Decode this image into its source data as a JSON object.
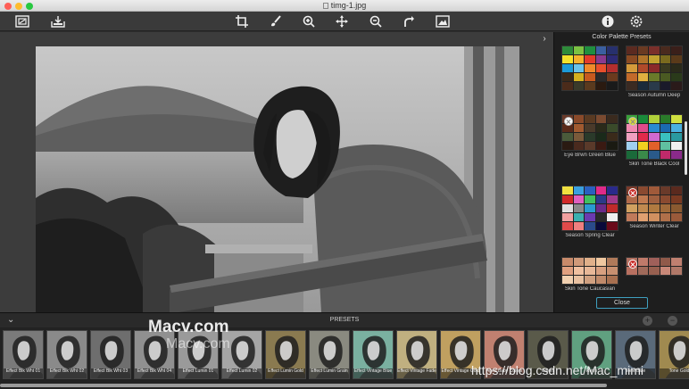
{
  "window": {
    "title": "timg-1.jpg",
    "lights": [
      "#fe5f57",
      "#febc2e",
      "#28c840"
    ]
  },
  "toolbar": {
    "left_icons": [
      "compare-icon",
      "save-icon"
    ],
    "center_icons": [
      "crop-icon",
      "brush-icon",
      "zoom-in-icon",
      "move-icon",
      "zoom-out-icon",
      "redo-icon",
      "fit-screen-icon"
    ],
    "right_icons": [
      "info-icon",
      "settings-icon"
    ]
  },
  "panel": {
    "title": "Color Palette Presets",
    "close_label": "Close",
    "palettes": [
      {
        "label": "",
        "badge": "none",
        "colors": [
          "#2e8b3a",
          "#7cc242",
          "#1f8f3f",
          "#3b5fa0",
          "#27306d",
          "#f2e22b",
          "#f6b12c",
          "#e33b2a",
          "#8a3a8e",
          "#2d2a75",
          "#1c9ad6",
          "#6bc3e9",
          "#f08a2a",
          "#e84f2c",
          "#b32e2e",
          "#3a2a1a",
          "#d4b020",
          "#c65a1f",
          "#2a2a2a",
          "#6b3a1e",
          "#4b2b1a",
          "#3a3a2a",
          "#5a3a1e",
          "#2a1a10",
          "#1a1a1a"
        ]
      },
      {
        "label": "Season Autumn Deep",
        "badge": "none",
        "colors": [
          "#5b2a20",
          "#6a3a22",
          "#7a2f2a",
          "#4a2a1e",
          "#3a1f1a",
          "#8a4a22",
          "#b0742a",
          "#c2a230",
          "#7a6a1e",
          "#5a3a1a",
          "#d49a3a",
          "#b04a2a",
          "#8a2a2a",
          "#3a3a20",
          "#2a2a1a",
          "#c26a2a",
          "#e0b040",
          "#6a7a2a",
          "#4a5a22",
          "#2a3a1a",
          "#3a2a22",
          "#1a2a3a",
          "#2a3a4a",
          "#1a1a2a",
          "#2a1a1a"
        ]
      },
      {
        "label": "Eye Brwn Green Blue",
        "badge": "grey",
        "colors": [
          "#6a3a2a",
          "#8a4a2a",
          "#5a3a22",
          "#7a4a30",
          "#3a2a1e",
          "#5a2a1a",
          "#a05a30",
          "#4a3a2a",
          "#2a2a1a",
          "#3a4a2a",
          "#4a5a3a",
          "#7a5a3a",
          "#2a3a2a",
          "#1a2a1a",
          "#3a2a1a",
          "#2a1a12",
          "#4a2a1e",
          "#5a3a2a",
          "#3a1a12",
          "#1a1a12"
        ]
      },
      {
        "label": "Skin Tone Black Cool",
        "badge": "yel",
        "colors": [
          "#3aa03a",
          "#1a8a3a",
          "#b0d03a",
          "#2a7a2a",
          "#d0e040",
          "#f08ab0",
          "#e04a8a",
          "#2a8ad0",
          "#1a6ab0",
          "#4ab0e0",
          "#f0a0c0",
          "#e02a4a",
          "#d06ad0",
          "#3ac0c0",
          "#2a9aa0",
          "#a0d0f0",
          "#f0d020",
          "#e0602a",
          "#60c0a0",
          "#f0f0f0",
          "#1a6a3a",
          "#3a8a4a",
          "#2a5a8a",
          "#c02a6a",
          "#8a2a8a"
        ]
      },
      {
        "label": "Season Spring Clear",
        "badge": "none",
        "colors": [
          "#f0e040",
          "#3aa0e0",
          "#2a60c0",
          "#e02a8a",
          "#2a2a8a",
          "#d02a2a",
          "#e060c0",
          "#40c060",
          "#2a3a8a",
          "#a03a8a",
          "#e0e0e0",
          "#8a8a8a",
          "#2a9ad0",
          "#6a2a8a",
          "#c02a2a",
          "#f0a0a0",
          "#3ab0b0",
          "#6a3ab0",
          "#2a2a2a",
          "#f0f0f0",
          "#e04a4a",
          "#f08080",
          "#2a4a8a",
          "#0a0a3a",
          "#6a0a1a"
        ]
      },
      {
        "label": "Season Winter Clear",
        "badge": "red",
        "colors": [
          "#7a3a2a",
          "#8a4a30",
          "#a05a3a",
          "#6a3a2a",
          "#5a2a1e",
          "#b06a4a",
          "#c07a50",
          "#a06040",
          "#8a4a30",
          "#7a3a22",
          "#d0a060",
          "#c08a50",
          "#b07a40",
          "#a06a3a",
          "#8a5a30",
          "#c07a5a",
          "#e0a070",
          "#d09060",
          "#b0704a",
          "#9a5a3a"
        ]
      },
      {
        "label": "Skin Tone Caucasian",
        "badge": "none",
        "colors": [
          "#c88a6a",
          "#d09a7a",
          "#e0b08a",
          "#f0c8a0",
          "#b07a5a",
          "#e0a080",
          "#f0c0a0",
          "#e8b898",
          "#d8a080",
          "#c89070",
          "#f0d0b0",
          "#e8c0a0",
          "#d0a080",
          "#c08a6a",
          "#a87050"
        ]
      },
      {
        "label": "",
        "badge": "red",
        "colors": [
          "#b07060",
          "#c07a6a",
          "#a0605a",
          "#905a4a",
          "#c08070",
          "#b87060",
          "#a06a5a",
          "#986050",
          "#c88878",
          "#b07868"
        ]
      }
    ]
  },
  "presets": {
    "label": "PRESETS",
    "items": [
      {
        "label": "Effect Blk Wht 01",
        "tint": "#7a7a7a"
      },
      {
        "label": "Effect Blk Wht 02",
        "tint": "#8a8a8a"
      },
      {
        "label": "Effect Blk Wht 03",
        "tint": "#6e6e6e"
      },
      {
        "label": "Effect Blk Wht 04",
        "tint": "#909090"
      },
      {
        "label": "Effect Lumin 01",
        "tint": "#9a9a9a"
      },
      {
        "label": "Effect Lumin 02",
        "tint": "#a5a5a5"
      },
      {
        "label": "Effect Lumin Gold",
        "tint": "#8a7a50"
      },
      {
        "label": "Effect Lumin Grain",
        "tint": "#8a8a80"
      },
      {
        "label": "Effect Vintage Blue",
        "tint": "#7ab0a0"
      },
      {
        "label": "Effect Vintage Fade",
        "tint": "#c0b080"
      },
      {
        "label": "Effect Vintage Gold",
        "tint": "#c0a060"
      },
      {
        "label": "Aged Baby Colors",
        "tint": "#c08070"
      },
      {
        "label": "Colors",
        "tint": "#5a5a4a"
      },
      {
        "label": "Retro",
        "tint": "#60a080"
      },
      {
        "label": "Tone Blue",
        "tint": "#5a6a7a"
      },
      {
        "label": "Tone Gold",
        "tint": "#a08a50"
      }
    ]
  },
  "watermark": {
    "text1": "Macv.com",
    "text2": "Macv.com",
    "text3": "https://blog.csdn.net/Mac_mimi"
  }
}
